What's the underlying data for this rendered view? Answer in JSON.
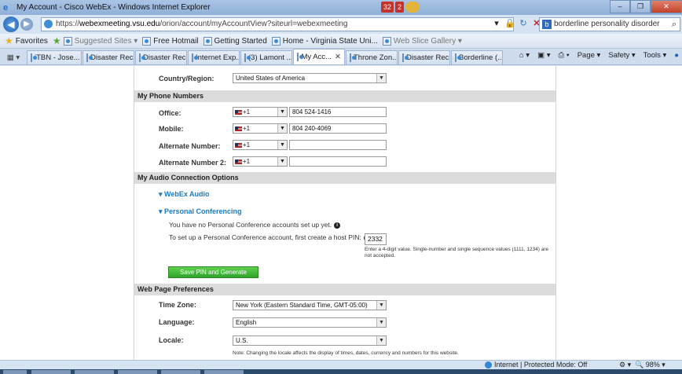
{
  "window": {
    "title": "My Account - Cisco WebEx - Windows Internet Explorer",
    "badges": [
      "32",
      "2"
    ],
    "buttons": [
      "–",
      "❐",
      "✕"
    ]
  },
  "addressbar": {
    "url_prefix": "https://",
    "url_host": "webexmeeting.vsu.edu",
    "url_path": "/orion/account/myAccountView?siteurl=webexmeeting",
    "search_value": "borderline personality disorder"
  },
  "favorites": {
    "label": "Favorites",
    "items": [
      "Suggested Sites ▾",
      "Free Hotmail",
      "Getting Started",
      "Home - Virginia State Uni...",
      "Web Slice Gallery ▾"
    ]
  },
  "tabs": {
    "items": [
      "iTBN - Jose...",
      "Disaster Rec...",
      "Disaster Rec...",
      "Internet Exp...",
      "(3) Lamont ...",
      "My Acc...",
      "Throne Zon...",
      "Disaster Rec...",
      "Borderline (..."
    ],
    "active_index": 5,
    "tools": [
      "Page ▾",
      "Safety ▾",
      "Tools ▾"
    ]
  },
  "form": {
    "country_label": "Country/Region:",
    "country_value": "United States of America",
    "phone_section": "My Phone Numbers",
    "phones": [
      {
        "label": "Office:",
        "code": "+1",
        "number": "804 524-1416"
      },
      {
        "label": "Mobile:",
        "code": "+1",
        "number": "804 240-4069"
      },
      {
        "label": "Alternate Number:",
        "code": "+1",
        "number": ""
      },
      {
        "label": "Alternate Number 2:",
        "code": "+1",
        "number": ""
      }
    ],
    "audio_section": "My Audio Connection Options",
    "webex_audio": "▾ WebEx Audio",
    "personal_conf": "▾ Personal Conferencing",
    "no_accounts": "You have no Personal Conference accounts set up yet.",
    "setup_text": "To set up a Personal Conference account, first create a host PIN:",
    "pin_value": "2332",
    "pin_note": "Enter a 4-digit value. Single-number and single sequence values (1111, 1234) are not accepted.",
    "save_button": "Save PIN and Generate Account",
    "prefs_section": "Web Page Preferences",
    "timezone_label": "Time Zone:",
    "timezone_value": "New York (Eastern Standard Time, GMT-05:00)",
    "language_label": "Language:",
    "language_value": "English",
    "locale_label": "Locale:",
    "locale_value": "U.S.",
    "locale_note": "Note: Changing the locale affects the display of times, dates, currency and numbers for this website."
  },
  "status": {
    "zone": "Internet | Protected Mode: Off",
    "zoom": "98%"
  }
}
